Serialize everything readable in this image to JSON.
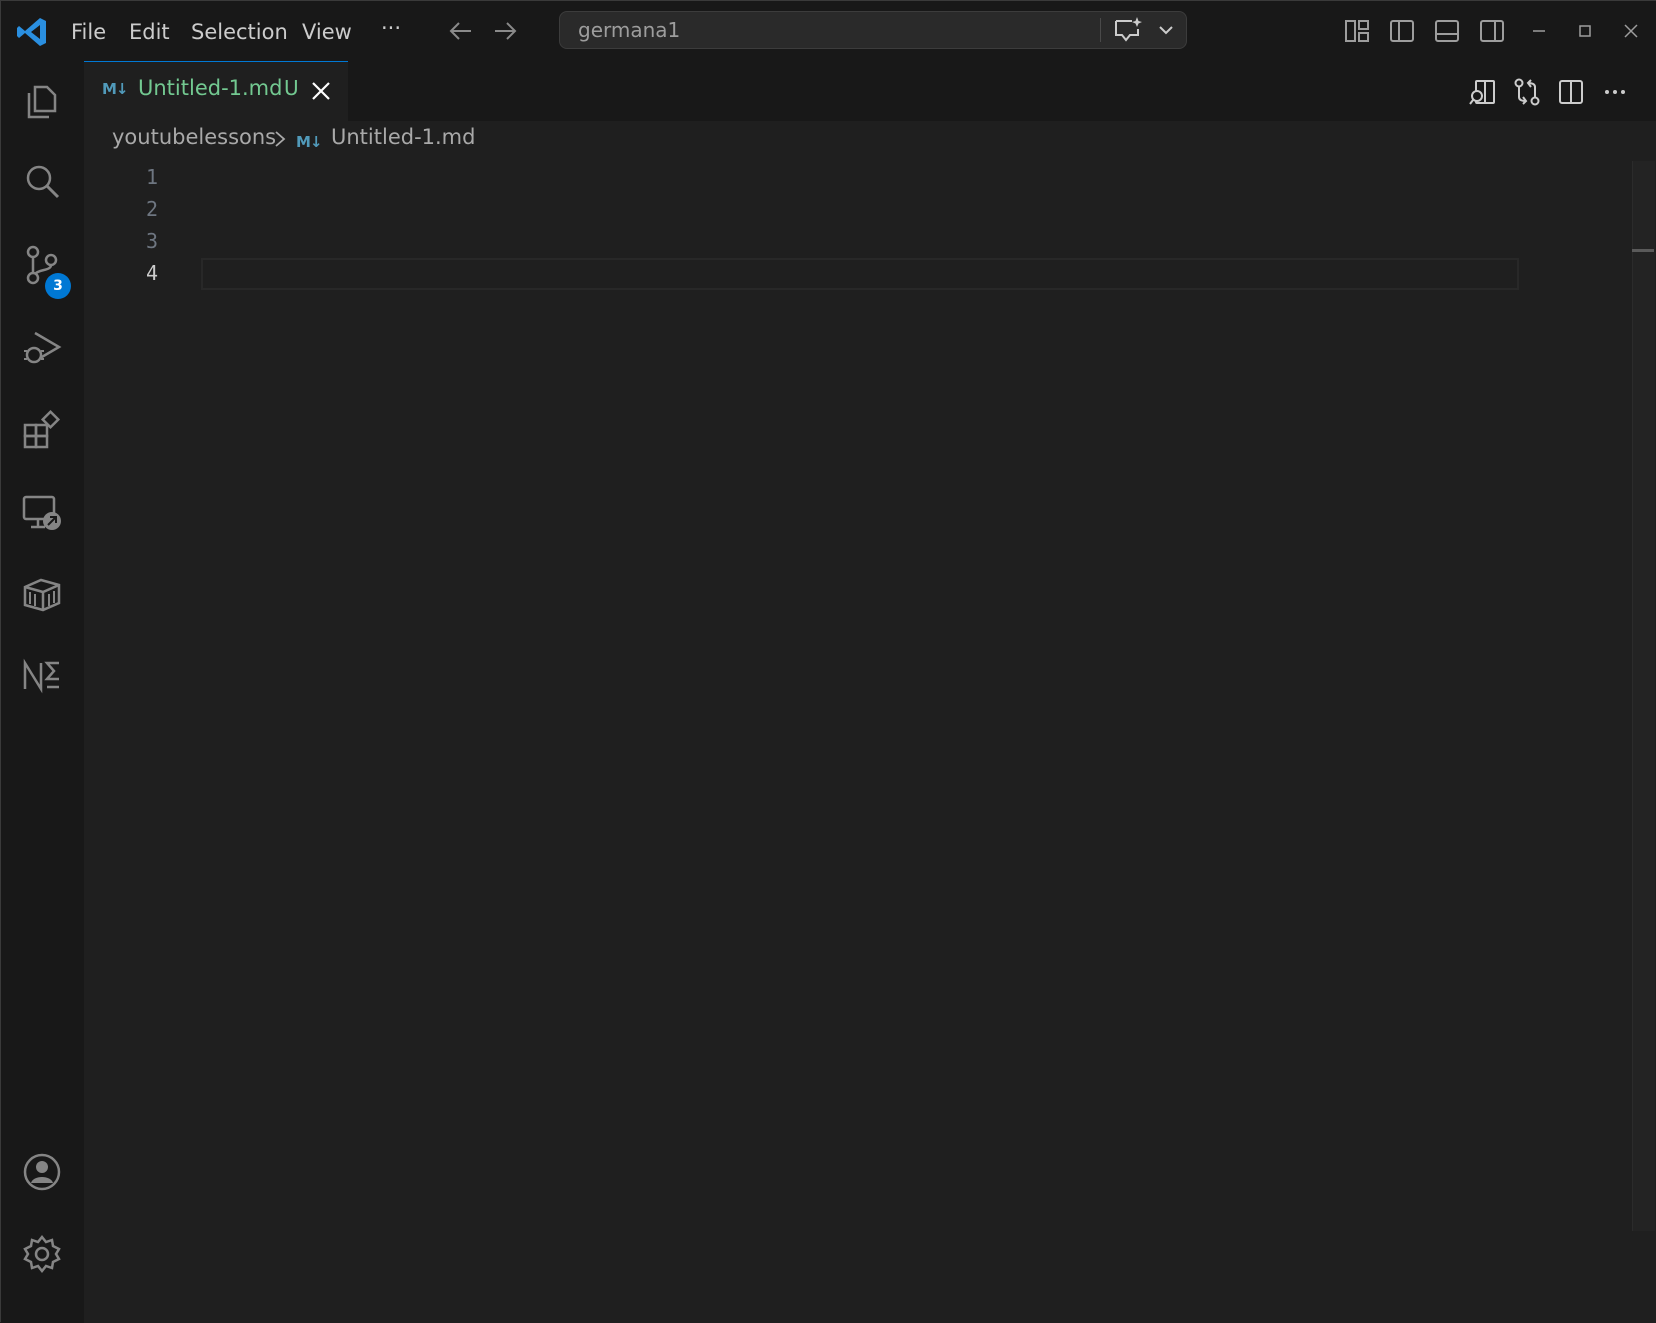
{
  "titlebar": {
    "menu": [
      "File",
      "Edit",
      "Selection",
      "View",
      "···"
    ],
    "command_center": "germana1"
  },
  "activity_bar": {
    "icons": [
      "explorer-icon",
      "search-icon",
      "source-control-icon",
      "run-debug-icon",
      "extensions-icon",
      "remote-explorer-icon",
      "containers-icon",
      "notebook-icon",
      "account-icon",
      "settings-gear-icon"
    ],
    "source_control_badge": "3"
  },
  "tab": {
    "icon": "M↓",
    "label": "Untitled-1.md",
    "status": "U"
  },
  "breadcrumb": {
    "folder": "youtubelessons",
    "icon": "M↓",
    "file": "Untitled-1.md"
  },
  "editor": {
    "line_numbers": [
      "1",
      "2",
      "3",
      "4"
    ],
    "active_line": 4
  },
  "colors": {
    "accent": "#0078d4",
    "modified_file": "#73c991",
    "markdown_icon": "#519aba",
    "background": "#1f1f1f",
    "chrome": "#181818"
  }
}
